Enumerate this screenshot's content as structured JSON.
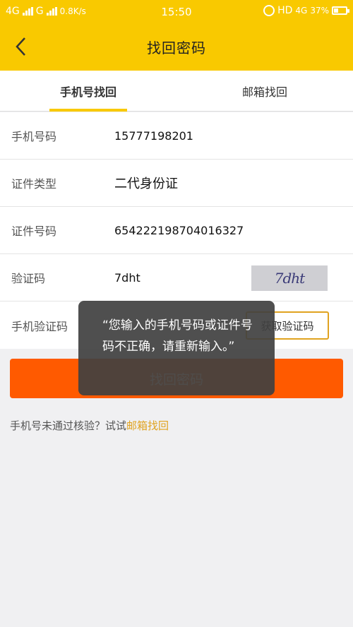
{
  "status_bar": {
    "network_left": "4G",
    "network_mid": "G",
    "speed": "0.8K/s",
    "time": "15:50",
    "network_right": "HD",
    "network_right2": "4G",
    "battery": "37%",
    "battery_level": 0.37
  },
  "header": {
    "title": "找回密码"
  },
  "tabs": [
    {
      "label": "手机号找回",
      "active": true
    },
    {
      "label": "邮箱找回",
      "active": false
    }
  ],
  "form": {
    "phone": {
      "label": "手机号码",
      "value": "15777198201"
    },
    "id_type": {
      "label": "证件类型",
      "value": "二代身份证"
    },
    "id_number": {
      "label": "证件号码",
      "value": "654222198704016327"
    },
    "captcha": {
      "label": "验证码",
      "value": "7dht",
      "image_text": "7dht"
    },
    "sms_code": {
      "label": "手机验证码",
      "button": "获取验证码"
    }
  },
  "submit_label": "找回密码",
  "hint": {
    "text": "手机号未通过核验？试试",
    "link": "邮箱找回"
  },
  "toast": {
    "message": "“您输入的手机号码或证件号码不正确，请重新输入。”"
  },
  "colors": {
    "brand_yellow": "#f9c900",
    "accent_orange": "#ff5a00",
    "link": "#e0a320"
  }
}
